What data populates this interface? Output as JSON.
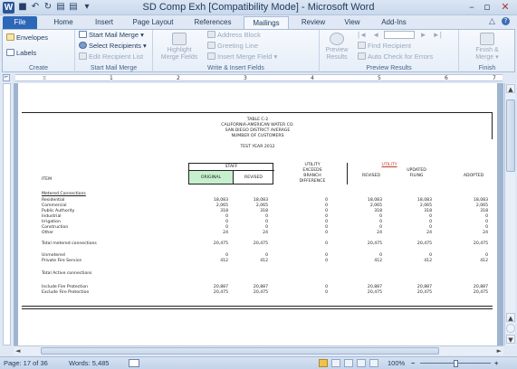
{
  "window": {
    "title": "SD Comp Exh [Compatibility Mode] - Microsoft Word",
    "app_letter": "W",
    "min_glyph": "–",
    "max_glyph": "▫",
    "close_glyph": "✕"
  },
  "quick_access": {
    "save_glyph": "■",
    "undo_glyph": "↶",
    "redo_glyph": "↻",
    "print_glyph": "▤",
    "more_glyph": "▾"
  },
  "tabs": [
    "File",
    "Home",
    "Insert",
    "Page Layout",
    "References",
    "Mailings",
    "Review",
    "View",
    "Add-Ins"
  ],
  "tab_icons": {
    "minimize_ribbon": "△",
    "help": "?"
  },
  "ribbon": {
    "create": {
      "label": "Create",
      "envelopes": "Envelopes",
      "labels": "Labels"
    },
    "start": {
      "label": "Start Mail Merge",
      "start_mail_merge": "Start Mail Merge ▾",
      "select_recipients": "Select Recipients ▾",
      "edit_recipient_list": "Edit Recipient List"
    },
    "write": {
      "label": "Write & Insert Fields",
      "highlight_line1": "Highlight",
      "highlight_line2": "Merge Fields",
      "address_block": "Address Block",
      "greeting_line": "Greeting Line",
      "insert_merge_field": "Insert Merge Field ▾"
    },
    "preview": {
      "label": "Preview Results",
      "preview_line1": "Preview",
      "preview_line2": "Results",
      "find_recipient": "Find Recipient",
      "auto_check": "Auto Check for Errors"
    },
    "finish": {
      "label": "Finish",
      "finish_line1": "Finish &",
      "finish_line2": "Merge ▾"
    }
  },
  "ruler": {
    "corner_glyph": "⌐",
    "numbers": [
      "1",
      "2",
      "3",
      "4",
      "5",
      "6",
      "7"
    ]
  },
  "statusbar": {
    "page": "Page: 17 of 36",
    "words": "Words: 5,485",
    "zoom": "100%",
    "zoom_minus": "−",
    "zoom_plus": "+"
  },
  "scroll": {
    "up": "▲",
    "down": "▼",
    "left": "◄",
    "right": "►"
  },
  "document": {
    "header": [
      "TABLE C-2",
      "CALIFORNIA-AMERICAN WATER CO.",
      "SAN DIEGO DISTRICT AVERAGE",
      "NUMBER OF CUSTOMERS"
    ],
    "test_year": "TEST YEAR 2012",
    "staff_label": "STAFF",
    "col_original": "ORIGINAL",
    "col_revised_staff": "REVISED",
    "col_utility_exceeds": [
      "UTILITY",
      "EXCEEDS",
      "BRANCH",
      "DIFFERENCE"
    ],
    "utility_label": "UTILITY",
    "col_revised": "REVISED",
    "col_updated": [
      "UPDATED",
      "FILING"
    ],
    "col_adopted": "ADOPTED",
    "col_item": "ITEM",
    "section_metered": "Metered Connections",
    "rows": [
      {
        "item": "Residential",
        "orig": "18,083",
        "rev": "18,083",
        "diff": "0",
        "urev": "18,083",
        "upd": "18,083",
        "adopted": "18,083"
      },
      {
        "item": "Commercial",
        "orig": "2,065",
        "rev": "2,065",
        "diff": "0",
        "urev": "2,065",
        "upd": "2,065",
        "adopted": "2,065"
      },
      {
        "item": "Public Authority",
        "orig": "318",
        "rev": "318",
        "diff": "0",
        "urev": "318",
        "upd": "318",
        "adopted": "318"
      },
      {
        "item": "Industrial",
        "orig": "0",
        "rev": "0",
        "diff": "0",
        "urev": "0",
        "upd": "0",
        "adopted": "0"
      },
      {
        "item": "Irrigation",
        "orig": "0",
        "rev": "0",
        "diff": "0",
        "urev": "0",
        "upd": "0",
        "adopted": "0"
      },
      {
        "item": "Construction",
        "orig": "0",
        "rev": "0",
        "diff": "0",
        "urev": "0",
        "upd": "0",
        "adopted": "0"
      },
      {
        "item": "Other",
        "orig": "24",
        "rev": "24",
        "diff": "0",
        "urev": "24",
        "upd": "24",
        "adopted": "24"
      }
    ],
    "total_metered": {
      "item": "Total metered connections",
      "orig": "20,475",
      "rev": "20,475",
      "diff": "0",
      "urev": "20,475",
      "upd": "20,475",
      "adopted": "20,475"
    },
    "unmetered": {
      "item": "Unmetered",
      "orig": "0",
      "rev": "0",
      "diff": "0",
      "urev": "0",
      "upd": "0",
      "adopted": "0"
    },
    "private_fire": {
      "item": "Private Fire Service",
      "orig": "412",
      "rev": "412",
      "diff": "0",
      "urev": "412",
      "upd": "412",
      "adopted": "412"
    },
    "section_total_active": "Total Active connections",
    "include_fire": {
      "item": "Include Fire Protection",
      "orig": "20,887",
      "rev": "20,887",
      "diff": "0",
      "urev": "20,887",
      "upd": "20,887",
      "adopted": "20,887"
    },
    "exclude_fire": {
      "item": "Exclude Fire Protection",
      "orig": "20,475",
      "rev": "20,475",
      "diff": "0",
      "urev": "20,475",
      "upd": "20,475",
      "adopted": "20,475"
    }
  },
  "colors": {
    "accent": "#2d67b8",
    "original_fill": "#c6efce",
    "utility_red": "#c0392b"
  }
}
